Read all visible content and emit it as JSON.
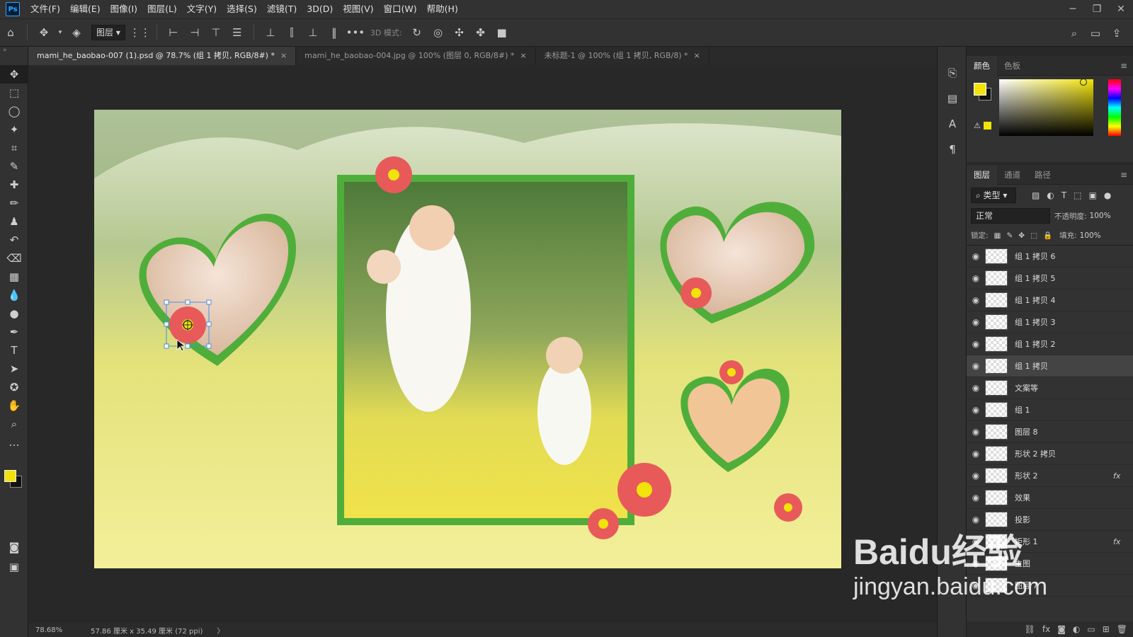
{
  "app": {
    "logo": "Ps"
  },
  "menu": [
    "文件(F)",
    "编辑(E)",
    "图像(I)",
    "图层(L)",
    "文字(Y)",
    "选择(S)",
    "滤镜(T)",
    "3D(D)",
    "视图(V)",
    "窗口(W)",
    "帮助(H)"
  ],
  "window_controls": {
    "minimize": "─",
    "restore": "❐",
    "close": "✕"
  },
  "options_bar": {
    "layer_select": "图层",
    "mode_label": "3D 模式:"
  },
  "tabs": [
    {
      "label": "mami_he_baobao-007 (1).psd @ 78.7% (组 1 拷贝, RGB/8#) *",
      "close": "×"
    },
    {
      "label": "mami_he_baobao-004.jpg @ 100% (图层 0, RGB/8#) *",
      "close": "×"
    },
    {
      "label": "未标题-1 @ 100% (组 1 拷贝, RGB/8) *",
      "close": "×"
    }
  ],
  "status": {
    "zoom": "78.68%",
    "doc_size": "57.86 厘米 x 35.49 厘米 (72 ppi)",
    "arrow": "〉"
  },
  "color_panel": {
    "tabs": [
      "颜色",
      "色板"
    ],
    "fg": "#f2e40a",
    "bg": "#111111"
  },
  "layers_panel": {
    "tabs": [
      "图层",
      "通道",
      "路径"
    ],
    "filter": "类型",
    "blend": "正常",
    "opacity_label": "不透明度:",
    "opacity": "100%",
    "lock_label": "锁定:",
    "fill_label": "填充:",
    "fill": "100%",
    "rows": [
      {
        "name": "组 1 拷贝 6",
        "selected": false,
        "fx": ""
      },
      {
        "name": "组 1 拷贝 5",
        "selected": false,
        "fx": ""
      },
      {
        "name": "组 1 拷贝 4",
        "selected": false,
        "fx": ""
      },
      {
        "name": "组 1 拷贝 3",
        "selected": false,
        "fx": ""
      },
      {
        "name": "组 1 拷贝 2",
        "selected": false,
        "fx": ""
      },
      {
        "name": "组 1 拷贝",
        "selected": true,
        "fx": ""
      },
      {
        "name": "文案等",
        "selected": false,
        "fx": ""
      },
      {
        "name": "组 1",
        "selected": false,
        "fx": ""
      },
      {
        "name": "图层 8",
        "selected": false,
        "fx": ""
      },
      {
        "name": "形状 2 拷贝",
        "selected": false,
        "fx": ""
      },
      {
        "name": "形状 2",
        "selected": false,
        "fx": "fx"
      },
      {
        "name": "效果",
        "selected": false,
        "fx": ""
      },
      {
        "name": "投影",
        "selected": false,
        "fx": ""
      },
      {
        "name": "矩形 1",
        "selected": false,
        "fx": "fx"
      },
      {
        "name": "主图",
        "selected": false,
        "fx": ""
      },
      {
        "name": "图层 7",
        "selected": false,
        "fx": ""
      }
    ]
  },
  "watermark": {
    "line1": "Baidu经验",
    "line2": "jingyan.baidu.com"
  },
  "colors": {
    "frame_green": "#4fae3a",
    "flower": "#e85a5a",
    "accent_yellow": "#f2e40a"
  }
}
